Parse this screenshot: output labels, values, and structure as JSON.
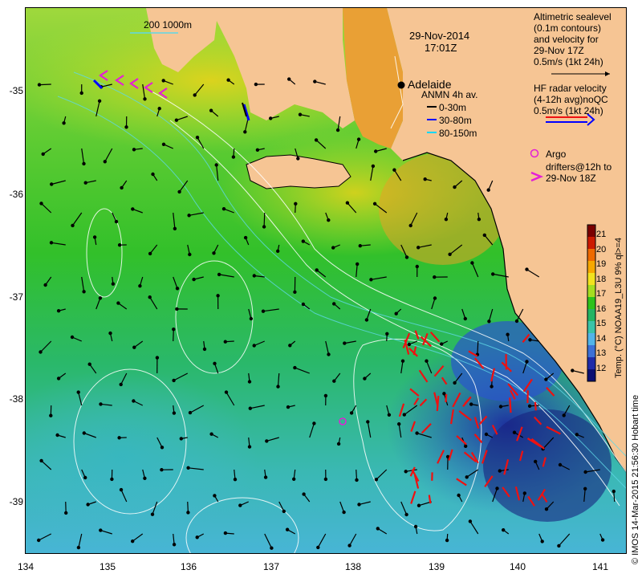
{
  "map": {
    "date": "29-Nov-2014",
    "time": "17:01Z",
    "city": "Adelaide",
    "credit": "© IMOS 14-Mar-2015 21:56:30 Hobart time",
    "lon_ticks": [
      "134",
      "135",
      "136",
      "137",
      "138",
      "139",
      "140",
      "141"
    ],
    "lat_ticks": [
      "-35",
      "-36",
      "-37",
      "-38",
      "-39"
    ],
    "scale_bar": "200 1000m"
  },
  "legend": {
    "altimetry": [
      "Altimetric sealevel",
      "(0.1m contours)",
      "and velocity for",
      "29-Nov 17Z",
      "0.5m/s (1kt 24h)"
    ],
    "hf_radar": [
      "HF radar velocity",
      "(4-12h avg)noQC",
      "0.5m/s (1kt 24h)"
    ],
    "anmn_title": "ANMN 4h av.",
    "anmn_items": [
      {
        "label": "0-30m",
        "color": "#000000"
      },
      {
        "label": "30-80m",
        "color": "#0000ff"
      },
      {
        "label": "80-150m",
        "color": "#00ffff"
      }
    ],
    "argo": "Argo",
    "drifters": [
      "drifters@12h to",
      "29-Nov 18Z"
    ]
  },
  "colorbar": {
    "title": "Temp. (°C) NOAA19_L3U 9% ql>=4",
    "ticks": [
      "21",
      "20",
      "19",
      "18",
      "17",
      "16",
      "15",
      "14",
      "13",
      "12"
    ],
    "colors": [
      "#7a0000",
      "#cc1a00",
      "#ee6a00",
      "#f7a800",
      "#f2e21e",
      "#a5dd20",
      "#2ec21b",
      "#25b463",
      "#3ac3a8",
      "#52b4e8",
      "#3d70d6",
      "#1f2ba8",
      "#0c0f72"
    ]
  },
  "colors": {
    "land": "#f6c594",
    "warm_sst": "#dcdd1f",
    "cool_sst": "#2ec21b",
    "cold_sst": "#2a3fc0",
    "hf_radar": "#ee1111",
    "drifter": "#e41ed7"
  }
}
